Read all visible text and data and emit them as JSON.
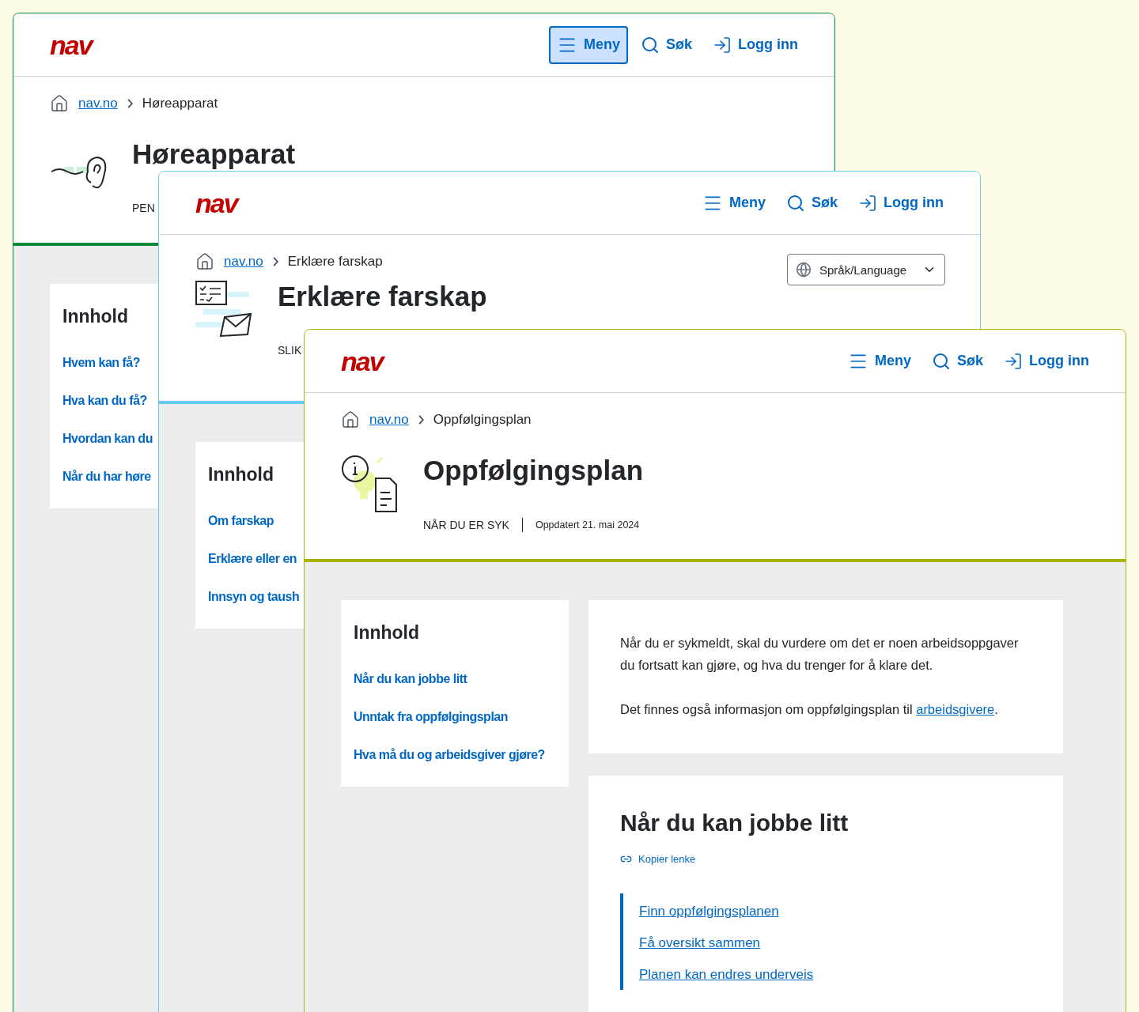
{
  "windows": [
    {
      "kind": "hearing",
      "color": "#06893a",
      "logo": "nav",
      "menu": {
        "label": "Meny",
        "active": true
      },
      "search": "Søk",
      "login": "Logg inn",
      "breadcrumb": {
        "home": "nav.no",
        "current": "Høreapparat"
      },
      "title": "Høreapparat",
      "category": "PEN",
      "toc": {
        "heading": "Innhold",
        "links": [
          "Hvem kan få?",
          "Hva kan du få?",
          "Hvordan kan du",
          "Når du har høre"
        ]
      }
    },
    {
      "kind": "form",
      "color": "#66cbec",
      "logo": "nav",
      "menu": {
        "label": "Meny",
        "active": false
      },
      "search": "Søk",
      "login": "Logg inn",
      "breadcrumb": {
        "home": "nav.no",
        "current": "Erklære farskap"
      },
      "language": "Språk/Language",
      "title": "Erklære farskap",
      "category": "SLIK",
      "toc": {
        "heading": "Innhold",
        "links": [
          "Om farskap",
          "Erklære eller en",
          "Innsyn og taush"
        ]
      }
    },
    {
      "kind": "info",
      "color": "#a8b400",
      "logo": "nav",
      "menu": {
        "label": "Meny",
        "active": false
      },
      "search": "Søk",
      "login": "Logg inn",
      "breadcrumb": {
        "home": "nav.no",
        "current": "Oppfølgingsplan"
      },
      "title": "Oppfølgingsplan",
      "category": "NÅR DU ER SYK",
      "updated": "Oppdatert 21. mai 2024",
      "toc": {
        "heading": "Innhold",
        "links": [
          "Når du kan jobbe litt",
          "Unntak fra oppfølgingsplan",
          "Hva må du og arbeidsgiver gjøre?"
        ]
      },
      "intro": {
        "paragraph": "Når du er sykmeldt, skal du vurdere om det er noen arbeidsoppgaver du fortsatt kan gjøre, og hva du trenger for å klare det.",
        "text": "Det finnes også informasjon om oppfølgingsplan til ",
        "link": "arbeidsgivere",
        "end": "."
      },
      "section": {
        "heading": "Når du kan jobbe litt",
        "copy_link": "Kopier lenke",
        "links": [
          "Finn oppfølgingsplanen",
          "Få oversikt sammen",
          "Planen kan endres underveis"
        ]
      }
    }
  ]
}
